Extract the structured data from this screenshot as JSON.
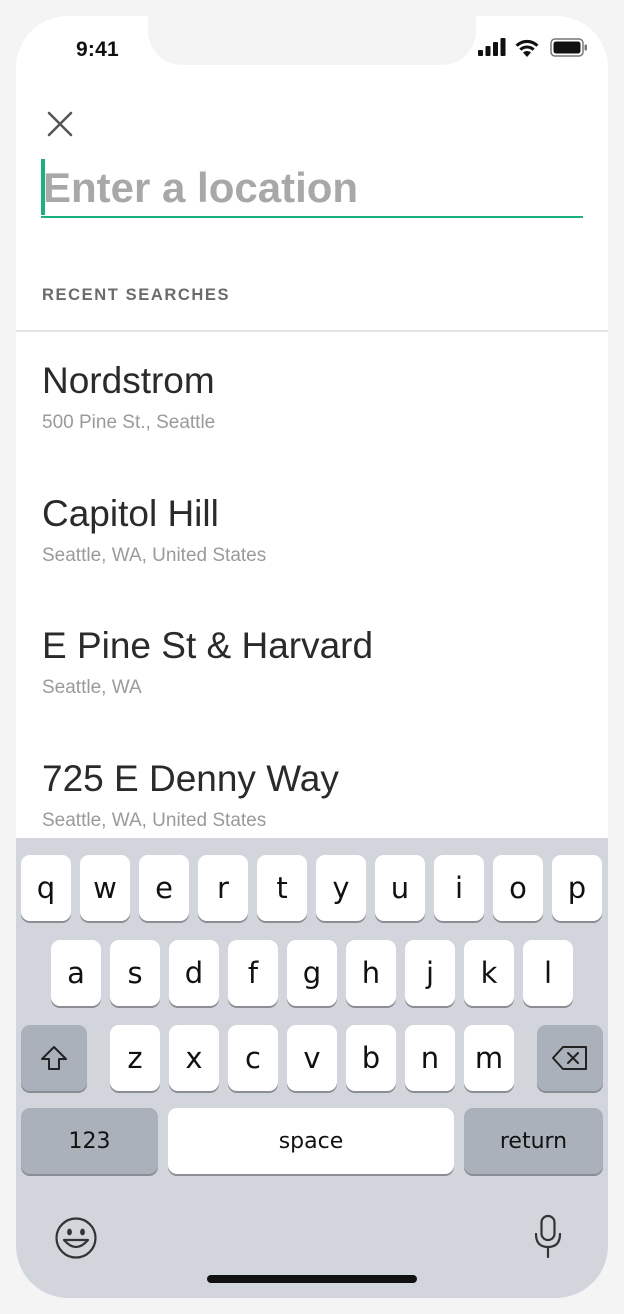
{
  "status_bar": {
    "time": "9:41"
  },
  "search": {
    "placeholder": "Enter a location",
    "value": ""
  },
  "recent": {
    "section_label": "RECENT SEARCHES",
    "items": [
      {
        "title": "Nordstrom",
        "subtitle": "500 Pine St., Seattle"
      },
      {
        "title": "Capitol Hill",
        "subtitle": "Seattle, WA, United States"
      },
      {
        "title": "E Pine St & Harvard",
        "subtitle": "Seattle, WA"
      },
      {
        "title": "725 E Denny Way",
        "subtitle": "Seattle, WA, United States"
      }
    ]
  },
  "keyboard": {
    "row1": [
      "q",
      "w",
      "e",
      "r",
      "t",
      "y",
      "u",
      "i",
      "o",
      "p"
    ],
    "row2": [
      "a",
      "s",
      "d",
      "f",
      "g",
      "h",
      "j",
      "k",
      "l"
    ],
    "row3": [
      "z",
      "x",
      "c",
      "v",
      "b",
      "n",
      "m"
    ],
    "numbers_label": "123",
    "space_label": "space",
    "return_label": "return"
  },
  "icons": {
    "close": "close-icon",
    "shift": "shift-icon",
    "delete": "backspace-icon",
    "emoji": "emoji-icon",
    "dictation": "microphone-icon",
    "signal": "cellular-signal-icon",
    "wifi": "wifi-icon",
    "battery": "battery-icon"
  },
  "colors": {
    "accent": "#1db07a",
    "keyboard_bg": "#d2d5db",
    "function_key": "#abb1ba"
  }
}
